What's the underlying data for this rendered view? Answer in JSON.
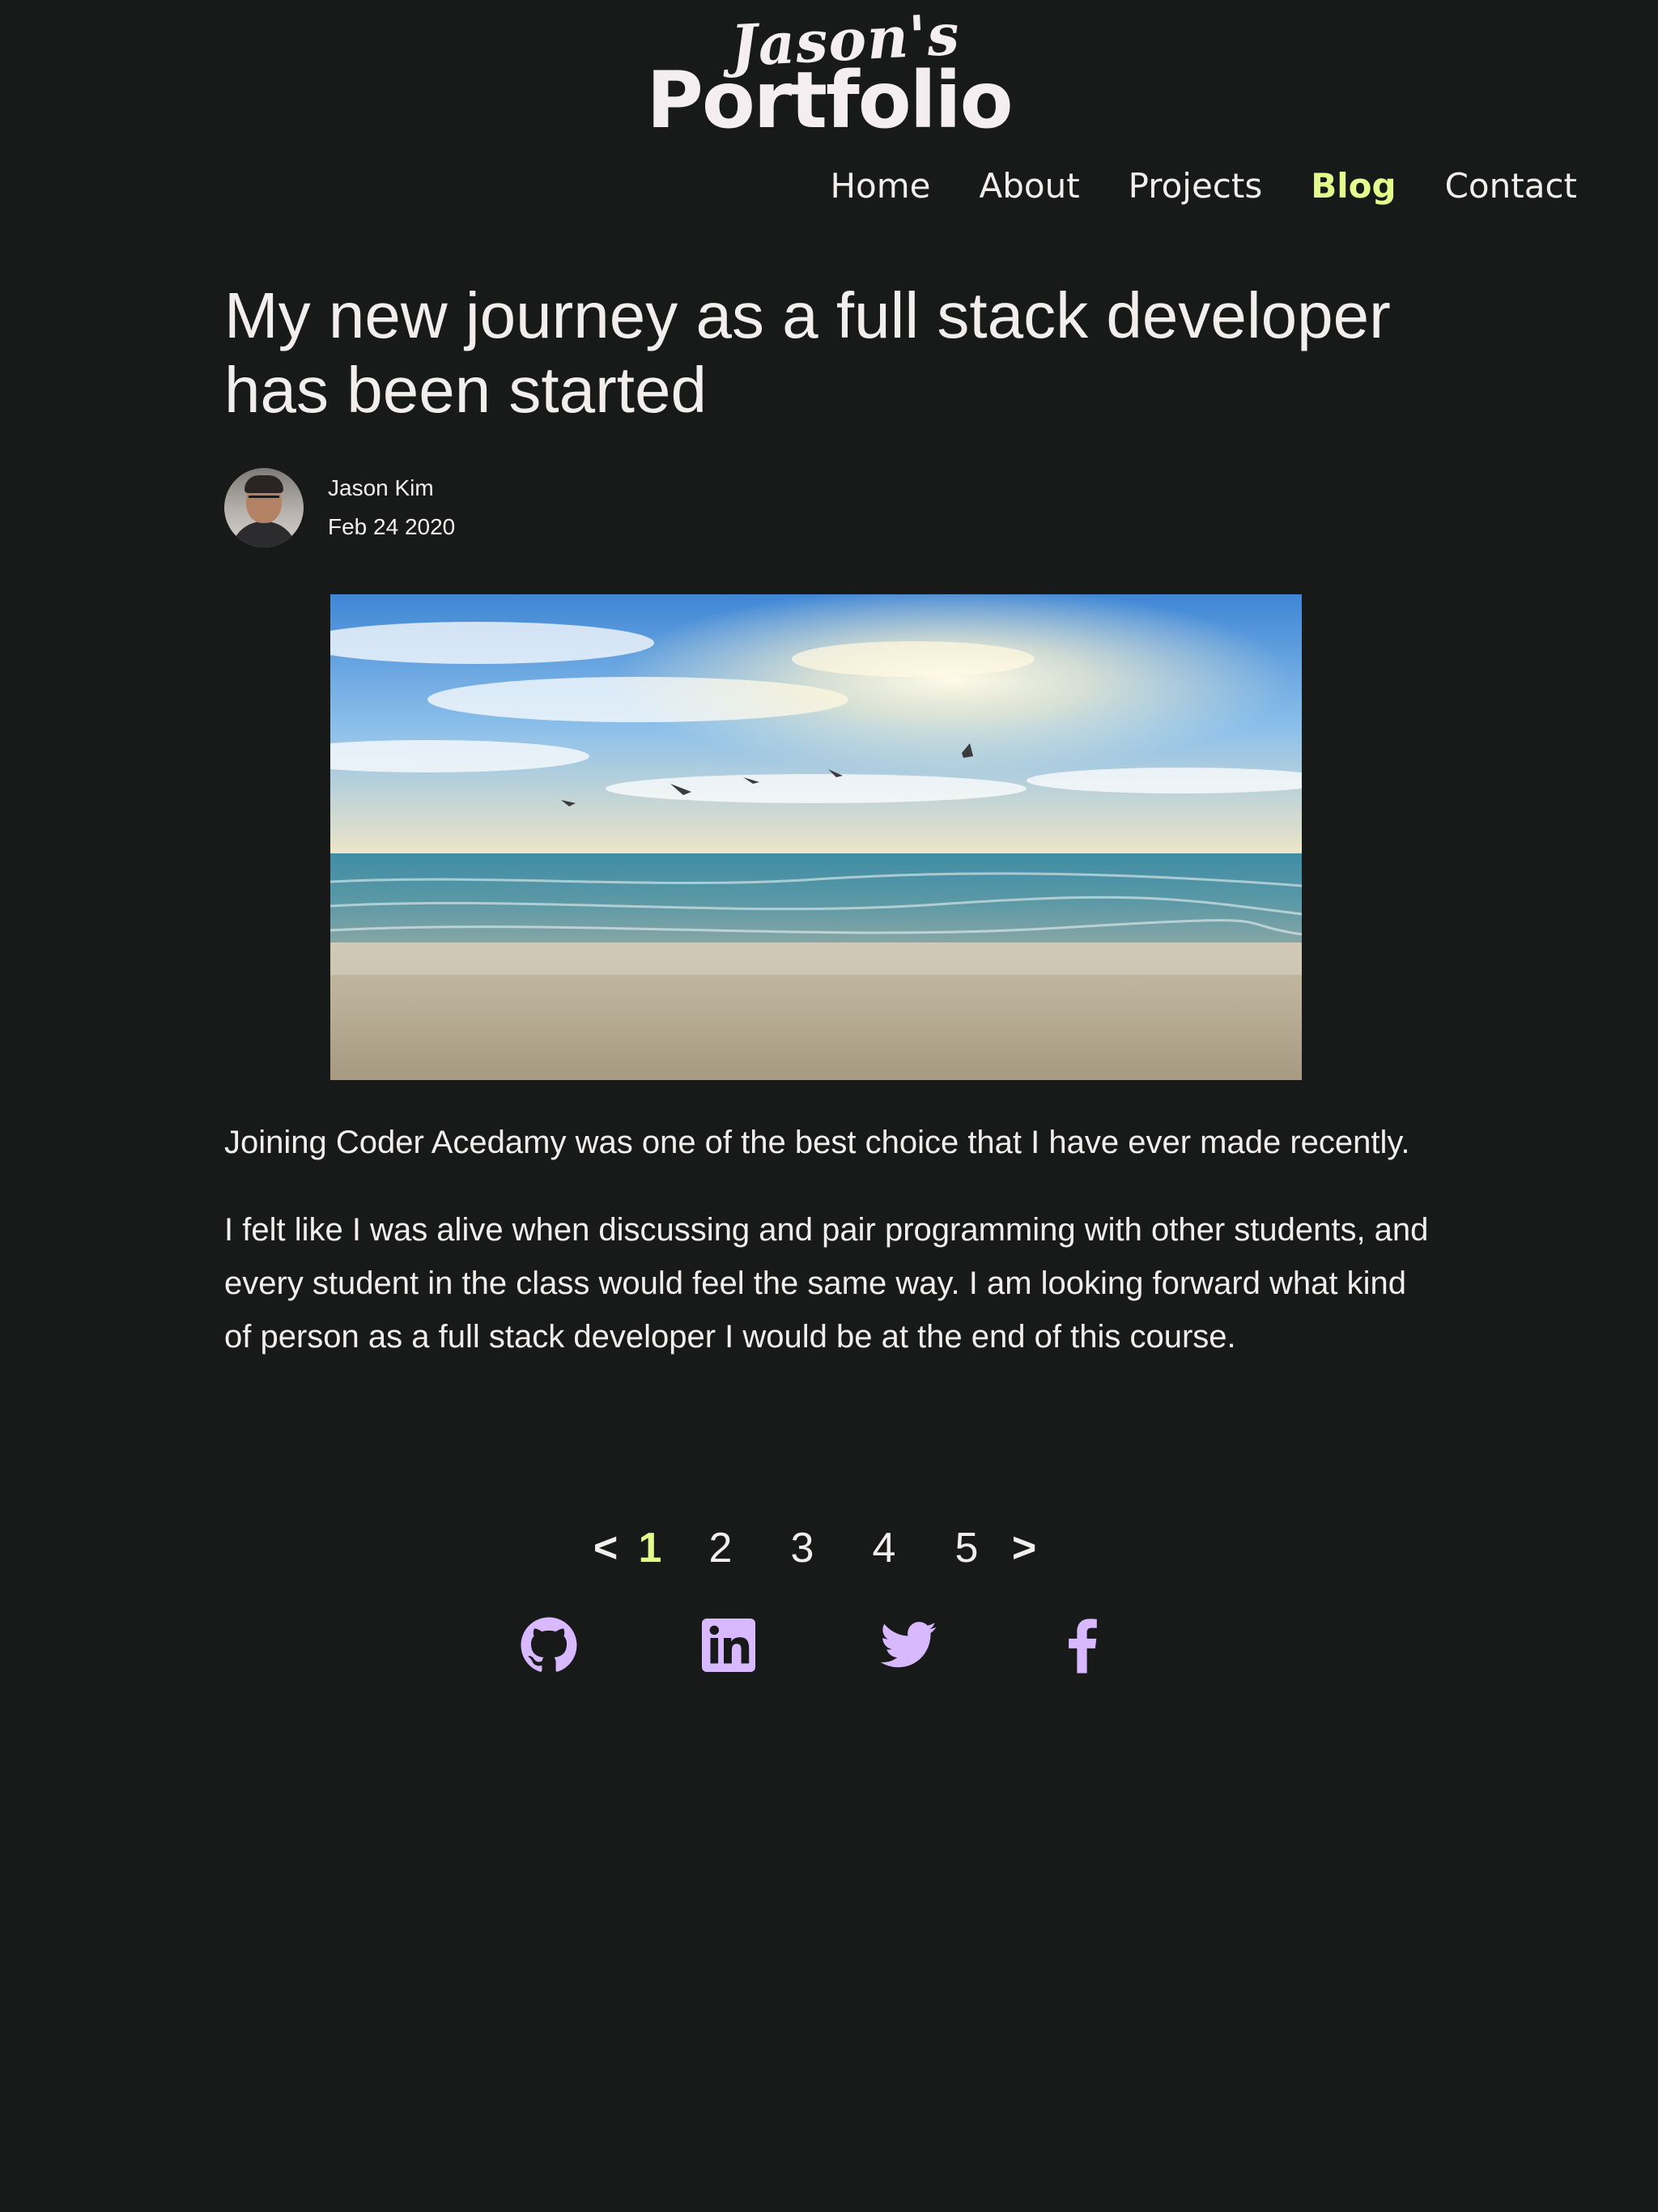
{
  "header": {
    "logo_script": "Jason's",
    "logo_main": "Portfolio"
  },
  "nav": {
    "items": [
      {
        "label": "Home",
        "active": false
      },
      {
        "label": "About",
        "active": false
      },
      {
        "label": "Projects",
        "active": false
      },
      {
        "label": "Blog",
        "active": true
      },
      {
        "label": "Contact",
        "active": false
      }
    ]
  },
  "article": {
    "title": "My new journey as a full stack developer has been started",
    "author": "Jason Kim",
    "date": "Feb 24 2020",
    "paragraphs": [
      "Joining Coder Acedamy was one of the best choice that I have ever made recently.",
      "I felt like I was alive when discussing and pair programming with other students, and every student in the class would feel the same way. I am looking forward what kind of person as a full stack developer I would be at the end of this course."
    ]
  },
  "pagination": {
    "prev": "<",
    "next": ">",
    "pages": [
      "1",
      "2",
      "3",
      "4",
      "5"
    ],
    "current": "1"
  },
  "social": {
    "icons": [
      "github-icon",
      "linkedin-icon",
      "twitter-icon",
      "facebook-icon"
    ]
  },
  "colors": {
    "background": "#171a19",
    "text": "#f3eeee",
    "accent": "#e2fb8c",
    "icon": "#d8b8ff"
  }
}
